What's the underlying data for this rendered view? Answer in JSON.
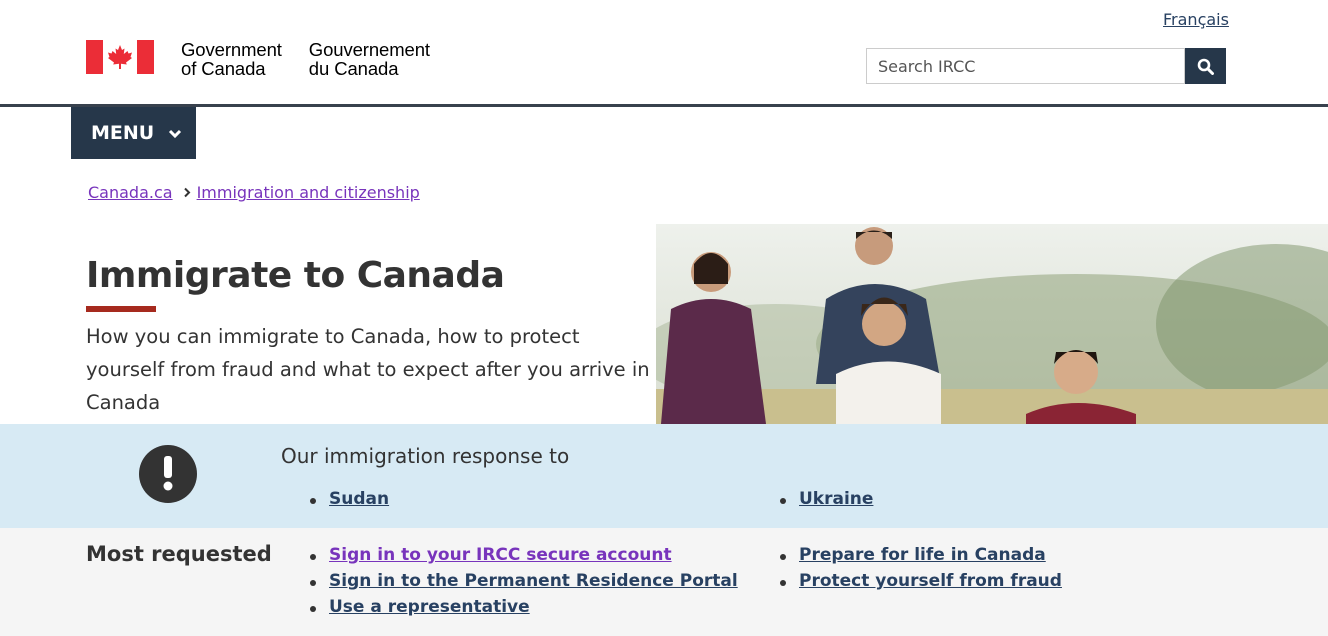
{
  "header": {
    "language_link": "Français",
    "signature_en_line1": "Government",
    "signature_en_line2": "of Canada",
    "signature_fr_line1": "Gouvernement",
    "signature_fr_line2": "du Canada",
    "search_placeholder": "Search IRCC",
    "menu_label": "MENU"
  },
  "breadcrumb": [
    {
      "label": "Canada.ca"
    },
    {
      "label": "Immigration and citizenship"
    }
  ],
  "hero": {
    "title": "Immigrate to Canada",
    "subtitle": "How you can immigrate to Canada, how to protect yourself from fraud and what to expect after you arrive in Canada"
  },
  "alert": {
    "title": "Our immigration response to",
    "links": [
      "Sudan",
      "Ukraine"
    ]
  },
  "most_requested": {
    "title": "Most requested",
    "links": [
      "Sign in to your IRCC secure account",
      "Sign in to the Permanent Residence Portal",
      "Use a representative",
      "Prepare for life in Canada",
      "Protect yourself from fraud"
    ]
  },
  "colors": {
    "nav_dark": "#26374a",
    "link": "#284162",
    "visited_link": "#7834bc",
    "title_underline": "#a62a1e",
    "alert_bg": "#d7eaf4",
    "most_requested_bg": "#f5f5f5",
    "flag_red": "#eb2d37"
  },
  "icons": [
    "maple-leaf-icon",
    "search-icon",
    "chevron-down-icon",
    "chevron-right-icon",
    "exclamation-icon"
  ]
}
